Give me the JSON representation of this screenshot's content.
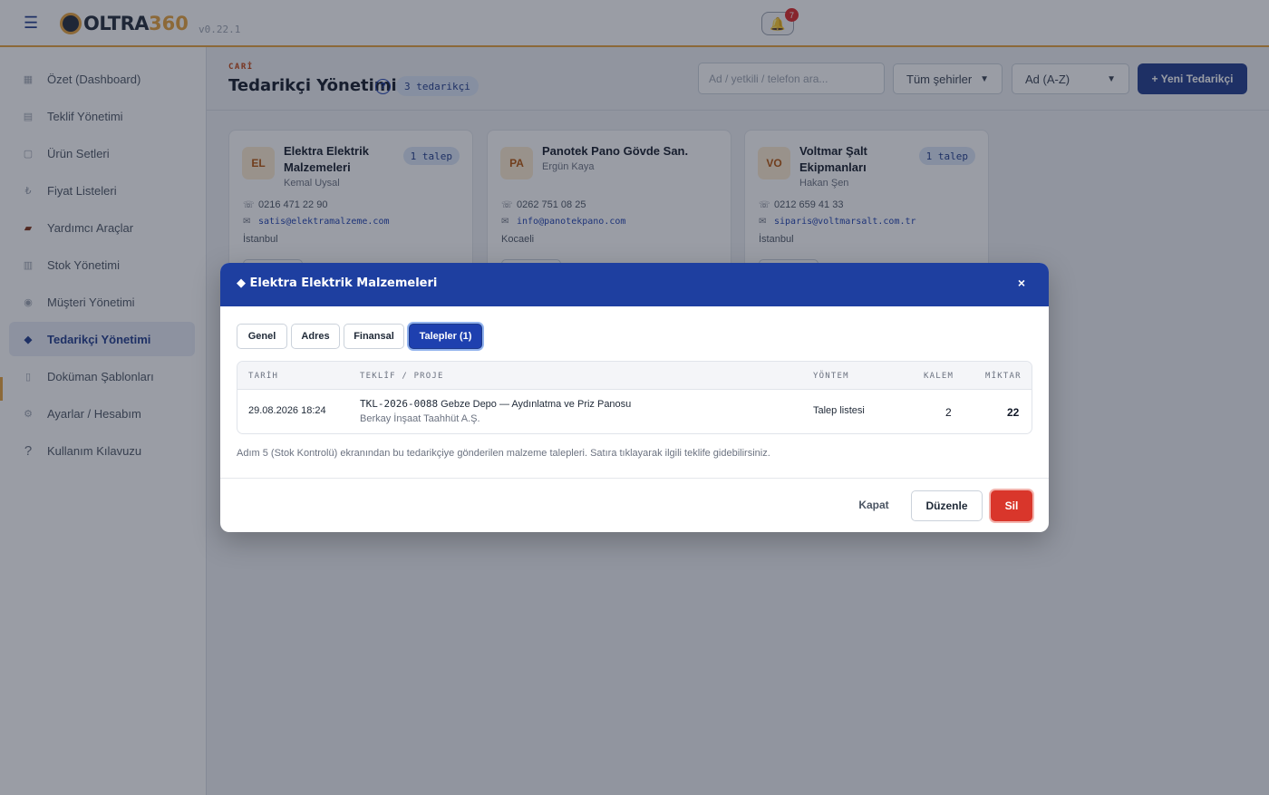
{
  "app": {
    "logo_text": "OLTRA",
    "logo_num": "360",
    "version": "v0.22.1",
    "notification_count": "7"
  },
  "sidebar": {
    "items": [
      {
        "label": "Özet (Dashboard)",
        "icon": "dashboard-icon"
      },
      {
        "label": "Teklif Yönetimi",
        "icon": "document-icon"
      },
      {
        "label": "Ürün Setleri",
        "icon": "box-icon"
      },
      {
        "label": "Fiyat Listeleri",
        "icon": "lira-icon"
      },
      {
        "label": "Yardımcı Araçlar",
        "icon": "toolbox-icon"
      },
      {
        "label": "Stok Yönetimi",
        "icon": "stock-icon"
      },
      {
        "label": "Müşteri Yönetimi",
        "icon": "customer-icon"
      },
      {
        "label": "Tedarikçi Yönetimi",
        "icon": "diamond-icon"
      },
      {
        "label": "Doküman Şablonları",
        "icon": "file-icon"
      },
      {
        "label": "Ayarlar / Hesabım",
        "icon": "gear-icon"
      },
      {
        "label": "Kullanım Kılavuzu",
        "icon": "question-icon"
      }
    ],
    "active_index": 7
  },
  "header": {
    "crumb": "CARİ",
    "title": "Tedarikçi Yönetimi",
    "help": "?",
    "count_badge": "3 tedarikçi",
    "search_placeholder": "Ad / yetkili / telefon ara...",
    "city_filter": "Tüm şehirler",
    "sort": "Ad (A-Z)",
    "new_button": "+ Yeni Tedarikçi"
  },
  "cards": [
    {
      "initials": "EL",
      "name": "Elektra Elektrik Malzemeleri",
      "person": "Kemal Uysal",
      "badge": "1 talep",
      "phone": "0216 471 22 90",
      "email": "satis@elektramalzeme.com",
      "city": "İstanbul"
    },
    {
      "initials": "PA",
      "name": "Panotek Pano Gövde San.",
      "person": "Ergün Kaya",
      "badge": "",
      "phone": "0262 751 08 25",
      "email": "info@panotekpano.com",
      "city": "Kocaeli"
    },
    {
      "initials": "VO",
      "name": "Voltmar Şalt Ekipmanları",
      "person": "Hakan Şen",
      "badge": "1 talep",
      "phone": "0212 659 41 33",
      "email": "siparis@voltmarsalt.com.tr",
      "city": "İstanbul"
    }
  ],
  "modal": {
    "title": "◆ Elektra Elektrik Malzemeleri",
    "close": "×",
    "tabs": [
      "Genel",
      "Adres",
      "Finansal",
      "Talepler (1)"
    ],
    "active_tab": 3,
    "columns": [
      "TARİH",
      "TEKLİF / PROJE",
      "YÖNTEM",
      "KALEM",
      "MİKTAR"
    ],
    "rows": [
      {
        "date": "29.08.2026 18:24",
        "code": "TKL-2026-0088",
        "project": "Gebze Depo — Aydınlatma ve Priz Panosu",
        "customer": "Berkay İnşaat Taahhüt A.Ş.",
        "method": "Talep listesi",
        "items": "2",
        "qty": "22"
      }
    ],
    "note": "Adım 5 (Stok Kontrolü) ekranından bu tedarikçiye gönderilen malzeme talepleri. Satıra tıklayarak ilgili teklife gidebilirsiniz.",
    "btn_close": "Kapat",
    "btn_edit": "Düzenle",
    "btn_delete": "Sil"
  }
}
